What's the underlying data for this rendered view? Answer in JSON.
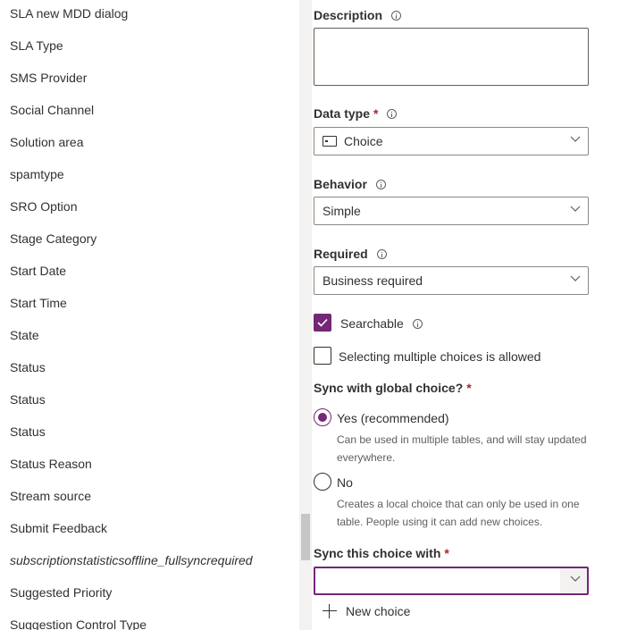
{
  "list": {
    "items": [
      {
        "label": "SLA new MDD dialog"
      },
      {
        "label": "SLA Type"
      },
      {
        "label": "SMS Provider"
      },
      {
        "label": "Social Channel"
      },
      {
        "label": "Solution area"
      },
      {
        "label": "spamtype"
      },
      {
        "label": "SRO Option"
      },
      {
        "label": "Stage Category"
      },
      {
        "label": "Start Date"
      },
      {
        "label": "Start Time"
      },
      {
        "label": "State"
      },
      {
        "label": "Status"
      },
      {
        "label": "Status"
      },
      {
        "label": "Status"
      },
      {
        "label": "Status Reason"
      },
      {
        "label": "Stream source"
      },
      {
        "label": "Submit Feedback"
      },
      {
        "label": "subscriptionstatisticsoffline_fullsyncrequired",
        "italic": true
      },
      {
        "label": "Suggested Priority"
      },
      {
        "label": "Suggestion Control Type"
      }
    ]
  },
  "form": {
    "description": {
      "label": "Description",
      "value": ""
    },
    "data_type": {
      "label": "Data type",
      "required_mark": "*",
      "value": "Choice"
    },
    "behavior": {
      "label": "Behavior",
      "value": "Simple"
    },
    "required": {
      "label": "Required",
      "value": "Business required"
    },
    "searchable": {
      "label": "Searchable",
      "checked": true
    },
    "multiple": {
      "label": "Selecting multiple choices is allowed",
      "checked": false
    },
    "sync_global": {
      "label": "Sync with global choice?",
      "required_mark": "*",
      "yes_label": "Yes (recommended)",
      "yes_desc": "Can be used in multiple tables, and will stay updated everywhere.",
      "no_label": "No",
      "no_desc": "Creates a local choice that can only be used in one table. People using it can add new choices.",
      "selected": "yes"
    },
    "sync_with": {
      "label": "Sync this choice with",
      "required_mark": "*",
      "value": ""
    },
    "new_choice": {
      "label": "New choice"
    }
  },
  "colors": {
    "accent": "#742774",
    "required": "#a4262c"
  }
}
